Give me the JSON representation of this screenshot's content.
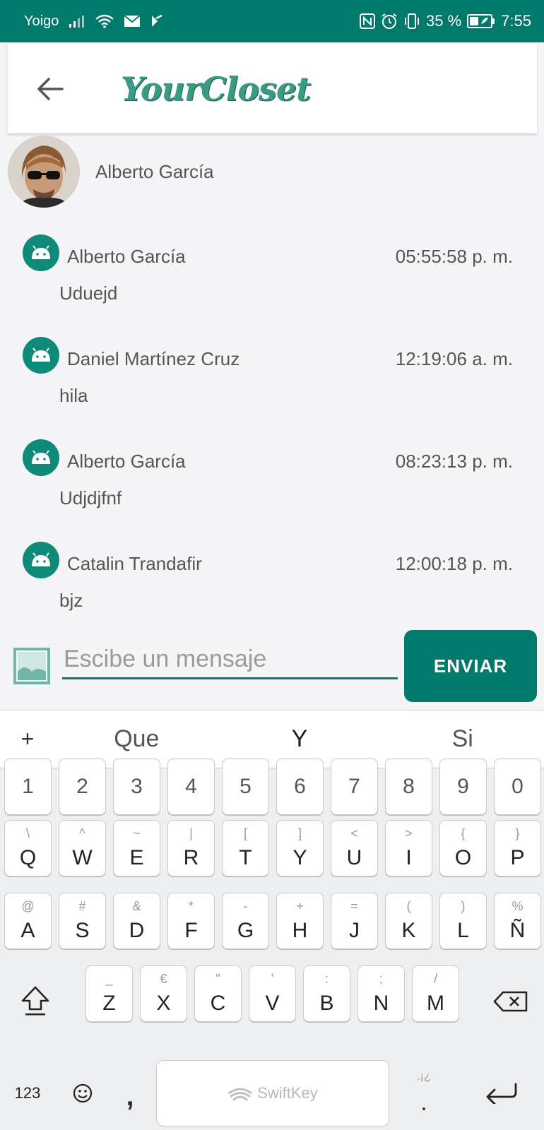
{
  "status_bar": {
    "carrier": "Yoigo",
    "battery": "35 %",
    "time": "7:55"
  },
  "header": {
    "title": "YourCloset"
  },
  "profile": {
    "name": "Alberto García"
  },
  "messages": [
    {
      "sender": "Alberto García",
      "time": "05:55:58 p. m.",
      "text": "Uduejd"
    },
    {
      "sender": "Daniel Martínez Cruz",
      "time": "12:19:06 a. m.",
      "text": "hila"
    },
    {
      "sender": "Alberto García",
      "time": "08:23:13 p. m.",
      "text": "Udjdjfnf"
    },
    {
      "sender": "Catalin Trandafir",
      "time": "12:00:18 p. m.",
      "text": "bjz"
    }
  ],
  "composer": {
    "placeholder": "Escibe un mensaje",
    "send_label": "ENVIAR"
  },
  "keyboard": {
    "suggestions": [
      "Que",
      "Y",
      "Si"
    ],
    "plus": "+",
    "numbers": [
      "1",
      "2",
      "3",
      "4",
      "5",
      "6",
      "7",
      "8",
      "9",
      "0"
    ],
    "row1": [
      {
        "k": "Q",
        "a": "\\"
      },
      {
        "k": "W",
        "a": "^"
      },
      {
        "k": "E",
        "a": "~"
      },
      {
        "k": "R",
        "a": "|"
      },
      {
        "k": "T",
        "a": "["
      },
      {
        "k": "Y",
        "a": "]"
      },
      {
        "k": "U",
        "a": "<"
      },
      {
        "k": "I",
        "a": ">"
      },
      {
        "k": "O",
        "a": "{"
      },
      {
        "k": "P",
        "a": "}"
      }
    ],
    "row2": [
      {
        "k": "A",
        "a": "@"
      },
      {
        "k": "S",
        "a": "#"
      },
      {
        "k": "D",
        "a": "&"
      },
      {
        "k": "F",
        "a": "*"
      },
      {
        "k": "G",
        "a": "-"
      },
      {
        "k": "H",
        "a": "+"
      },
      {
        "k": "J",
        "a": "="
      },
      {
        "k": "K",
        "a": "("
      },
      {
        "k": "L",
        "a": ")"
      },
      {
        "k": "Ñ",
        "a": "%"
      }
    ],
    "row3": [
      {
        "k": "Z",
        "a": "_"
      },
      {
        "k": "X",
        "a": "€"
      },
      {
        "k": "C",
        "a": "\""
      },
      {
        "k": "V",
        "a": "'"
      },
      {
        "k": "B",
        "a": ":"
      },
      {
        "k": "N",
        "a": ";"
      },
      {
        "k": "M",
        "a": "/"
      }
    ],
    "numbers_toggle": "123",
    "comma": ",",
    "period": ".",
    "period_alt": ".¡¿",
    "space_brand": "SwiftKey"
  },
  "colors": {
    "primary": "#01796b",
    "accent": "#0d8a78",
    "logo": "#3b9a83"
  }
}
